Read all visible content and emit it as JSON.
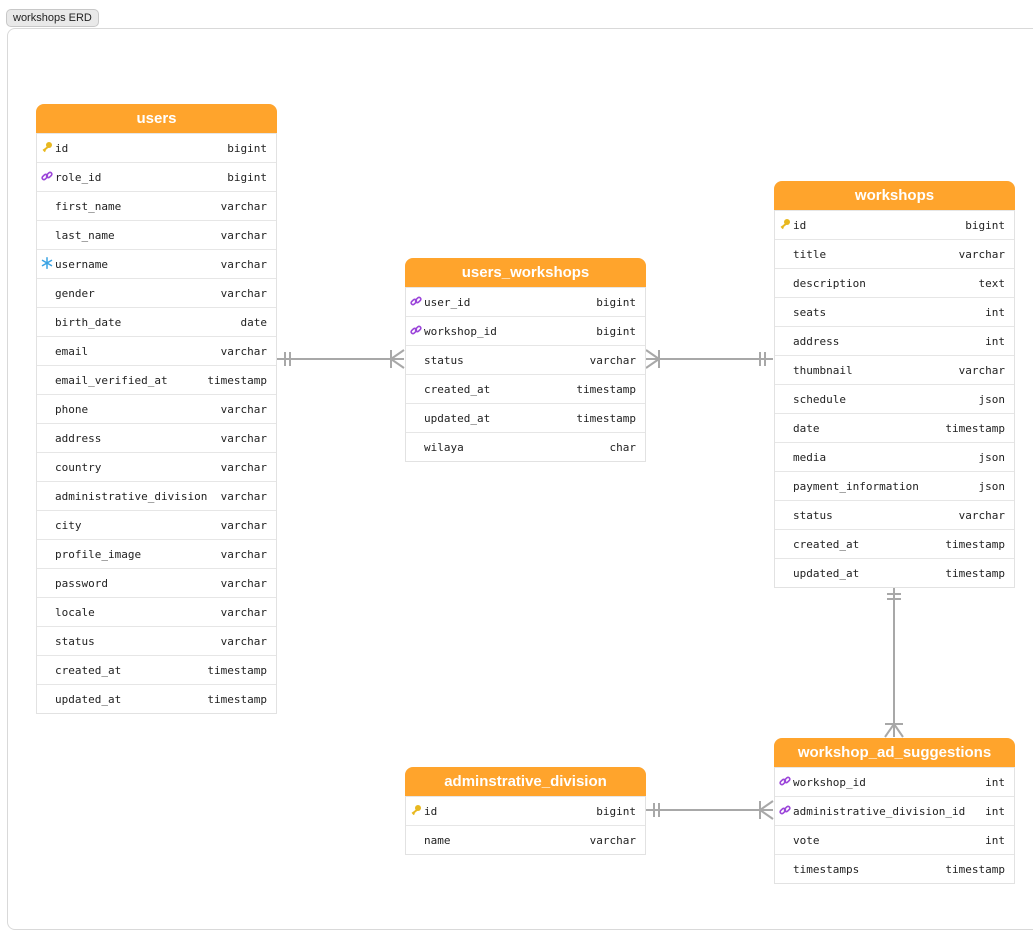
{
  "tab_label": "workshops ERD",
  "colors": {
    "header": "#ffa42c",
    "pk_icon": "#e8b820",
    "fk_icon": "#9b45d9",
    "unique_icon": "#3aa3e3",
    "link": "#a8a8a8"
  },
  "tables": {
    "users": {
      "name": "users",
      "columns": [
        {
          "name": "id",
          "type": "bigint",
          "icon": "key-icon"
        },
        {
          "name": "role_id",
          "type": "bigint",
          "icon": "link-icon"
        },
        {
          "name": "first_name",
          "type": "varchar"
        },
        {
          "name": "last_name",
          "type": "varchar"
        },
        {
          "name": "username",
          "type": "varchar",
          "icon": "snowflake-icon"
        },
        {
          "name": "gender",
          "type": "varchar"
        },
        {
          "name": "birth_date",
          "type": "date"
        },
        {
          "name": "email",
          "type": "varchar"
        },
        {
          "name": "email_verified_at",
          "type": "timestamp"
        },
        {
          "name": "phone",
          "type": "varchar"
        },
        {
          "name": "address",
          "type": "varchar"
        },
        {
          "name": "country",
          "type": "varchar"
        },
        {
          "name": "administrative_division",
          "type": "varchar"
        },
        {
          "name": "city",
          "type": "varchar"
        },
        {
          "name": "profile_image",
          "type": "varchar"
        },
        {
          "name": "password",
          "type": "varchar"
        },
        {
          "name": "locale",
          "type": "varchar"
        },
        {
          "name": "status",
          "type": "varchar"
        },
        {
          "name": "created_at",
          "type": "timestamp"
        },
        {
          "name": "updated_at",
          "type": "timestamp"
        }
      ]
    },
    "users_workshops": {
      "name": "users_workshops",
      "columns": [
        {
          "name": "user_id",
          "type": "bigint",
          "icon": "link-icon"
        },
        {
          "name": "workshop_id",
          "type": "bigint",
          "icon": "link-icon"
        },
        {
          "name": "status",
          "type": "varchar"
        },
        {
          "name": "created_at",
          "type": "timestamp"
        },
        {
          "name": "updated_at",
          "type": "timestamp"
        },
        {
          "name": "wilaya",
          "type": "char"
        }
      ]
    },
    "workshops": {
      "name": "workshops",
      "columns": [
        {
          "name": "id",
          "type": "bigint",
          "icon": "key-icon"
        },
        {
          "name": "title",
          "type": "varchar"
        },
        {
          "name": "description",
          "type": "text"
        },
        {
          "name": "seats",
          "type": "int"
        },
        {
          "name": "address",
          "type": "int"
        },
        {
          "name": "thumbnail",
          "type": "varchar"
        },
        {
          "name": "schedule",
          "type": "json"
        },
        {
          "name": "date",
          "type": "timestamp"
        },
        {
          "name": "media",
          "type": "json"
        },
        {
          "name": "payment_information",
          "type": "json"
        },
        {
          "name": "status",
          "type": "varchar"
        },
        {
          "name": "created_at",
          "type": "timestamp"
        },
        {
          "name": "updated_at",
          "type": "timestamp"
        }
      ]
    },
    "adminstrative_division": {
      "name": "adminstrative_division",
      "columns": [
        {
          "name": "id",
          "type": "bigint",
          "icon": "key-icon"
        },
        {
          "name": "name",
          "type": "varchar"
        }
      ]
    },
    "workshop_ad_suggestions": {
      "name": "workshop_ad_suggestions",
      "columns": [
        {
          "name": "workshop_id",
          "type": "int",
          "icon": "link-icon"
        },
        {
          "name": "administrative_division_id",
          "type": "int",
          "icon": "link-icon"
        },
        {
          "name": "vote",
          "type": "int"
        },
        {
          "name": "timestamps",
          "type": "timestamp"
        }
      ]
    }
  }
}
